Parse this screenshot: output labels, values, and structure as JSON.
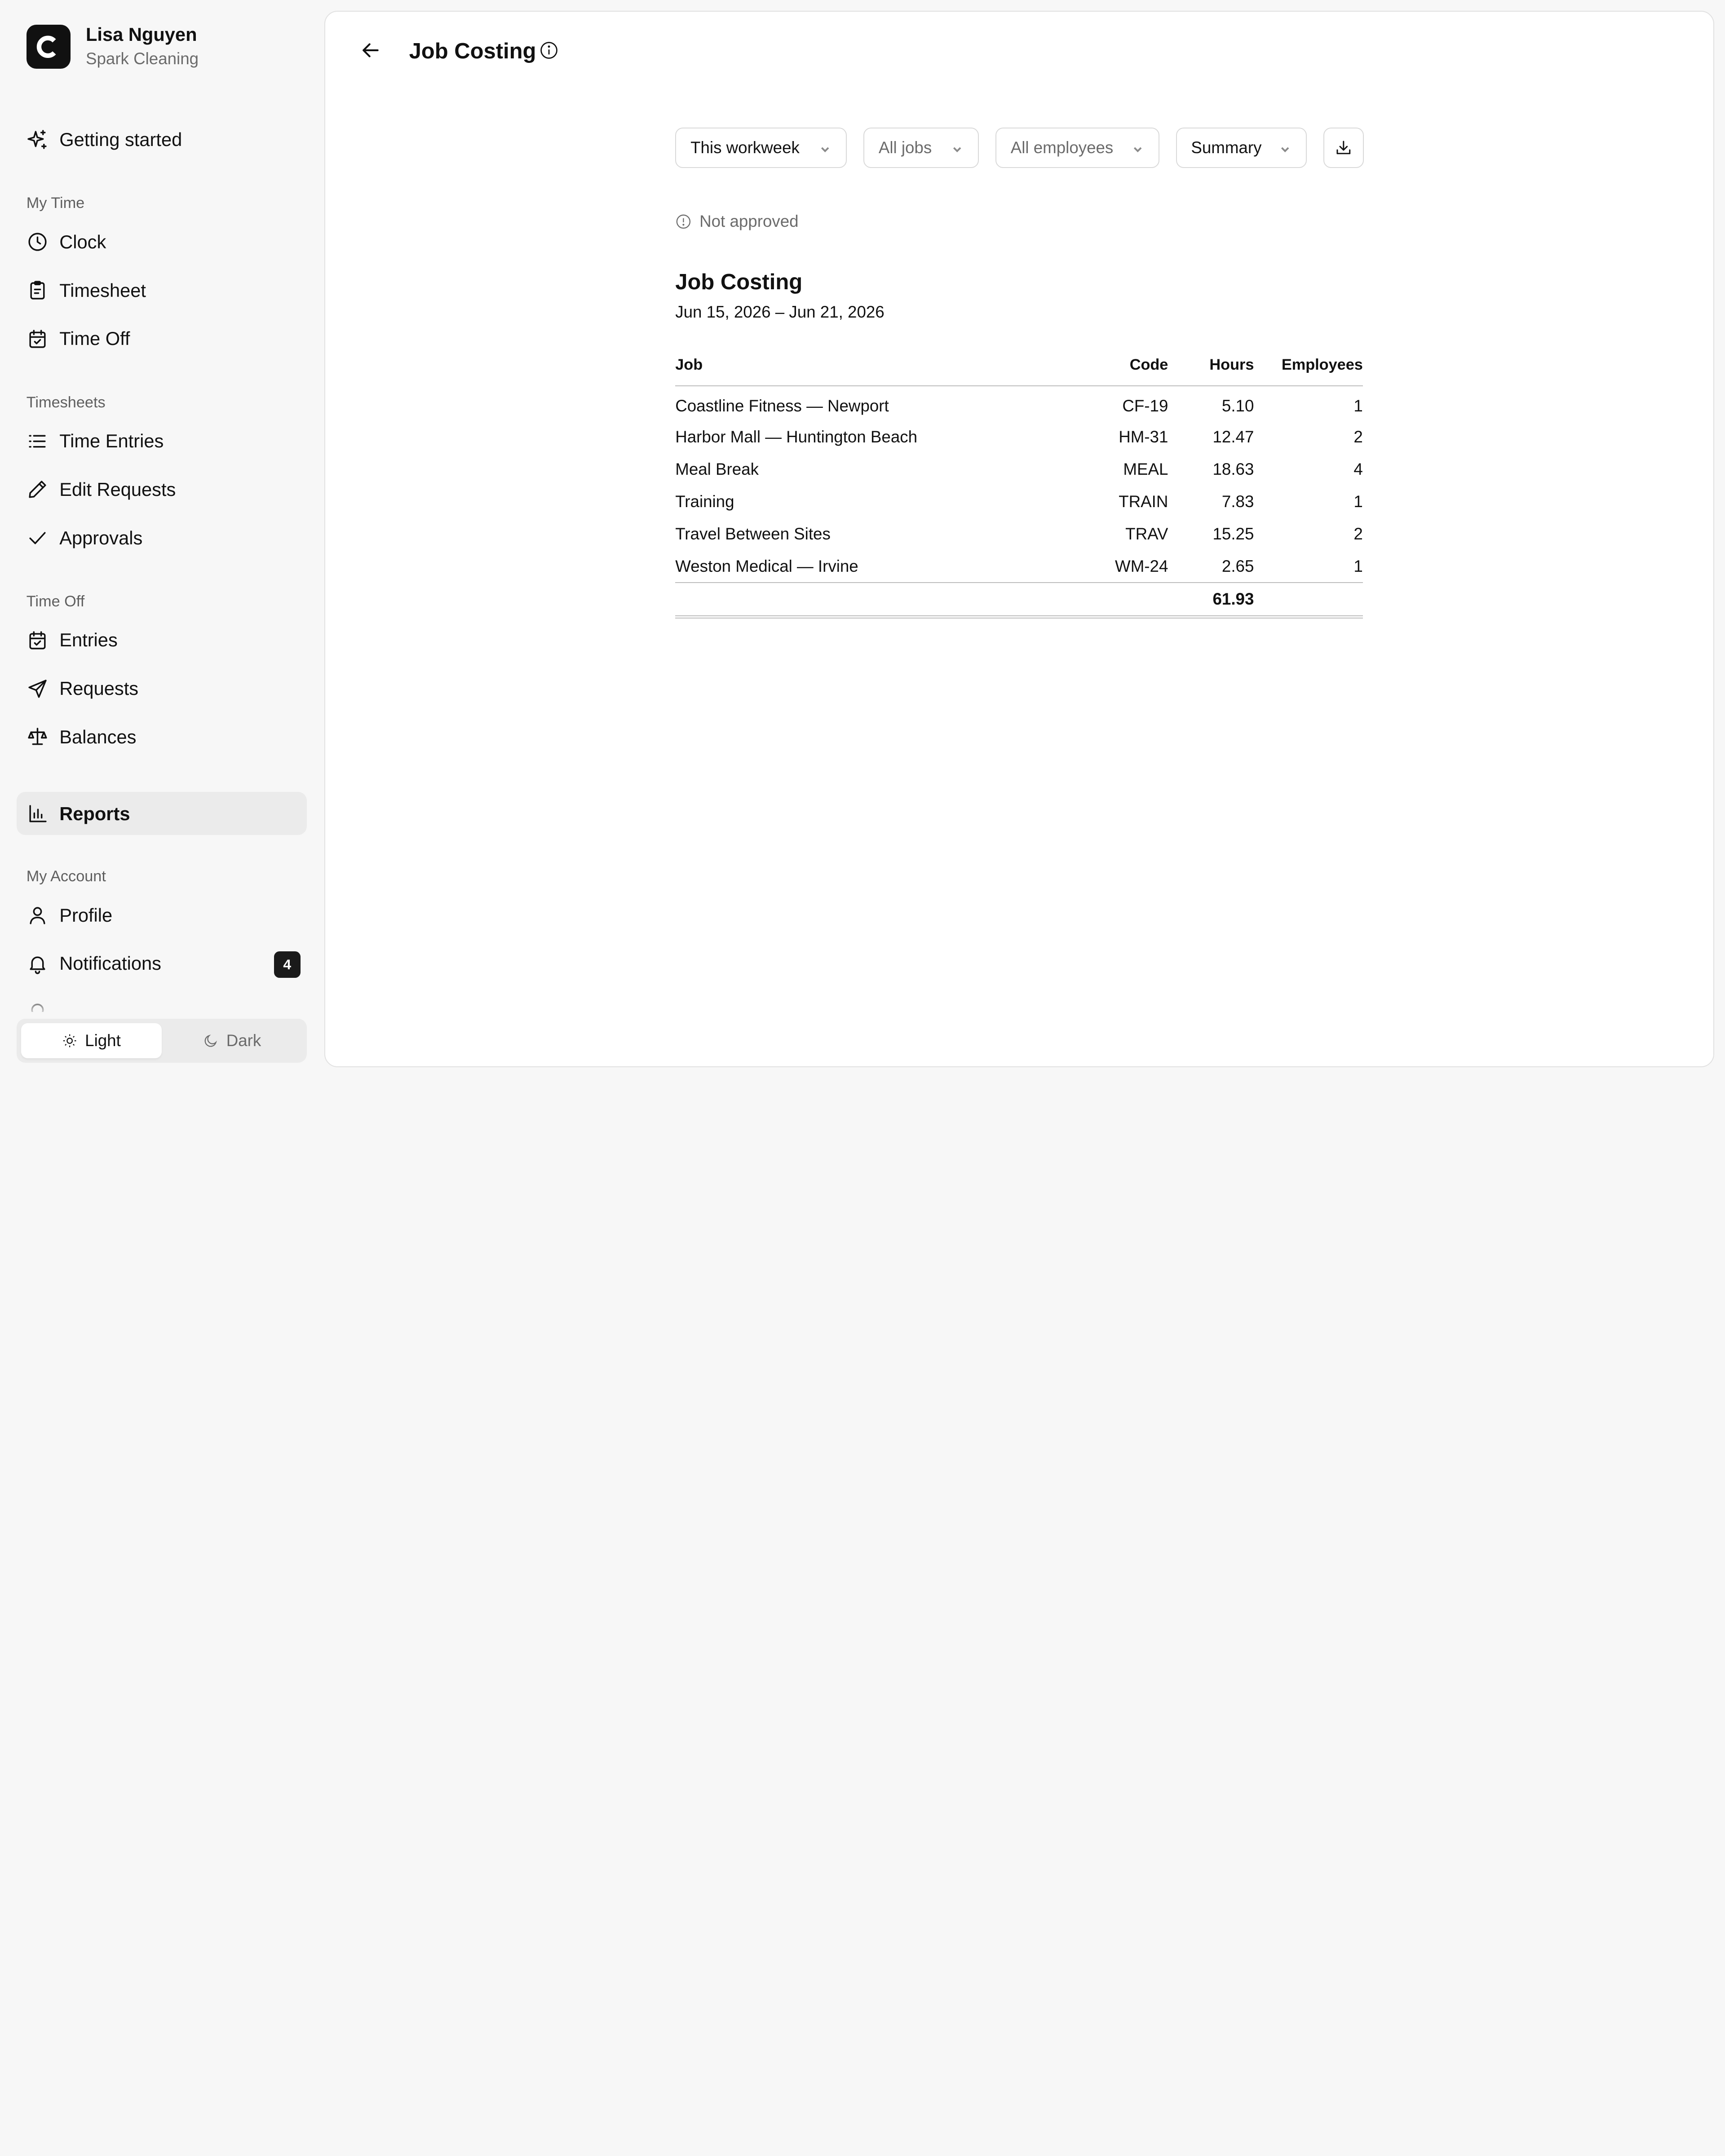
{
  "account": {
    "name": "Lisa Nguyen",
    "org": "Spark Cleaning",
    "logo_letter": "C"
  },
  "sidebar": {
    "getting_started": "Getting started",
    "sections": {
      "my_time": "My Time",
      "timesheets": "Timesheets",
      "time_off": "Time Off",
      "my_account": "My Account"
    },
    "items": {
      "clock": "Clock",
      "timesheet": "Timesheet",
      "time_off": "Time Off",
      "time_entries": "Time Entries",
      "edit_requests": "Edit Requests",
      "approvals": "Approvals",
      "entries": "Entries",
      "requests": "Requests",
      "balances": "Balances",
      "reports": "Reports",
      "profile": "Profile",
      "notifications": "Notifications"
    },
    "notifications_count": "4",
    "theme": {
      "light": "Light",
      "dark": "Dark",
      "selected": "Light"
    }
  },
  "header": {
    "title": "Job Costing"
  },
  "filters": {
    "period": "This workweek",
    "jobs": "All jobs",
    "employees": "All employees",
    "view": "Summary"
  },
  "status": "Not approved",
  "report": {
    "title": "Job Costing",
    "range": "Jun 15, 2026 – Jun 21, 2026",
    "columns": {
      "job": "Job",
      "code": "Code",
      "hours": "Hours",
      "employees": "Employees"
    },
    "rows": [
      {
        "job": "Coastline Fitness — Newport",
        "code": "CF-19",
        "hours": "5.10",
        "employees": "1"
      },
      {
        "job": "Harbor Mall — Huntington Beach",
        "code": "HM-31",
        "hours": "12.47",
        "employees": "2"
      },
      {
        "job": "Meal Break",
        "code": "MEAL",
        "hours": "18.63",
        "employees": "4"
      },
      {
        "job": "Training",
        "code": "TRAIN",
        "hours": "7.83",
        "employees": "1"
      },
      {
        "job": "Travel Between Sites",
        "code": "TRAV",
        "hours": "15.25",
        "employees": "2"
      },
      {
        "job": "Weston Medical — Irvine",
        "code": "WM-24",
        "hours": "2.65",
        "employees": "1"
      }
    ],
    "total_hours": "61.93"
  }
}
